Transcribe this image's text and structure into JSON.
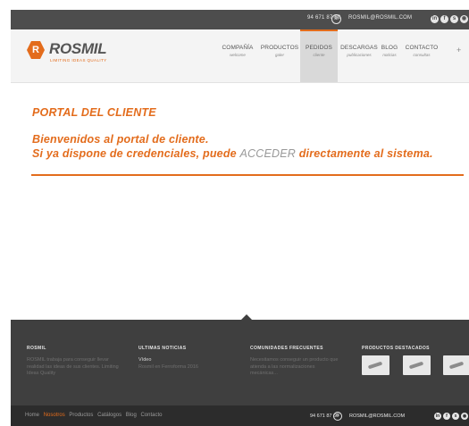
{
  "topbar": {
    "phone": "94 671 87 60",
    "email": "ROSMIL@ROSMIL.COM",
    "social_icons": [
      "linkedin-icon",
      "facebook-icon",
      "skype-icon",
      "rss-icon"
    ]
  },
  "brand": {
    "logo_letter": "R",
    "name": "ROSMIL",
    "tagline": "LIMITING IDEAS QUALITY",
    "accent": "#e36c1c"
  },
  "nav": [
    {
      "label": "COMPAÑÍA",
      "sub": "welcome"
    },
    {
      "label": "PRODUCTOS",
      "sub": "galer"
    },
    {
      "label": "PEDIDOS",
      "sub": "cliente"
    },
    {
      "label": "DESCARGAS",
      "sub": "publicaciones"
    },
    {
      "label": "BLOG",
      "sub": "noticias"
    },
    {
      "label": "CONTACTO",
      "sub": "consultas"
    }
  ],
  "nav_more": "+",
  "main": {
    "title": "PORTAL DEL CLIENTE",
    "welcome_line1": "Bienvenidos al portal de cliente.",
    "welcome_line2_pre": "Si ya dispone de credenciales, puede ",
    "welcome_link": "ACCEDER",
    "welcome_line2_post": " directamente al sistema."
  },
  "footer": {
    "col1": {
      "heading": "ROSMIL",
      "text": "ROSMIL trabaja para conseguir llevar realidad las ideas de sus clientes. Limiting Ideas Quality"
    },
    "col2": {
      "heading": "ULTIMAS NOTICIAS",
      "item_title": "Vídeo",
      "item_text": "Rosmil en Ferroforma 2016"
    },
    "col3": {
      "heading": "COMUNIDADES FRECUENTES",
      "text": "Necesitamos conseguir un producto que atienda a las normalizaciones mecánicas..."
    },
    "col4": {
      "heading": "PRODUCTOS DESTACADOS"
    }
  },
  "bottombar": {
    "links": [
      "Home",
      "Nosotros",
      "Productos",
      "Catálogos",
      "Blog",
      "Contacto"
    ],
    "phone": "94 671 87 60",
    "email": "ROSMIL@ROSMIL.COM",
    "social_icons": [
      "linkedin-icon",
      "facebook-icon",
      "skype-icon",
      "rss-icon"
    ]
  }
}
